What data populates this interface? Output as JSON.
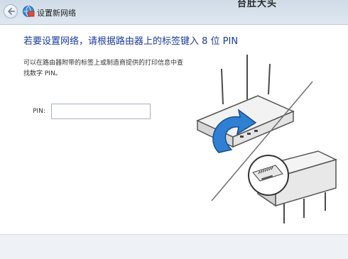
{
  "window": {
    "title": "设置新网络",
    "brand_fragment": "台肚大头"
  },
  "main": {
    "heading": "若要设置网络，请根据路由器上的标签键入 8 位 PIN",
    "description": "可以在路由器附带的标签上或制造商提供的打印信息中查找数字 PIN。",
    "pin_label": "PIN:",
    "pin_value": ""
  },
  "icons": {
    "back": "back-arrow-icon",
    "network": "network-icon",
    "router": "router-icon",
    "curved_arrow": "curved-arrow-icon",
    "router_label": "router-label-magnifier-icon"
  },
  "colors": {
    "heading": "#1a3c9c",
    "arrow": "#2f7fd2"
  }
}
